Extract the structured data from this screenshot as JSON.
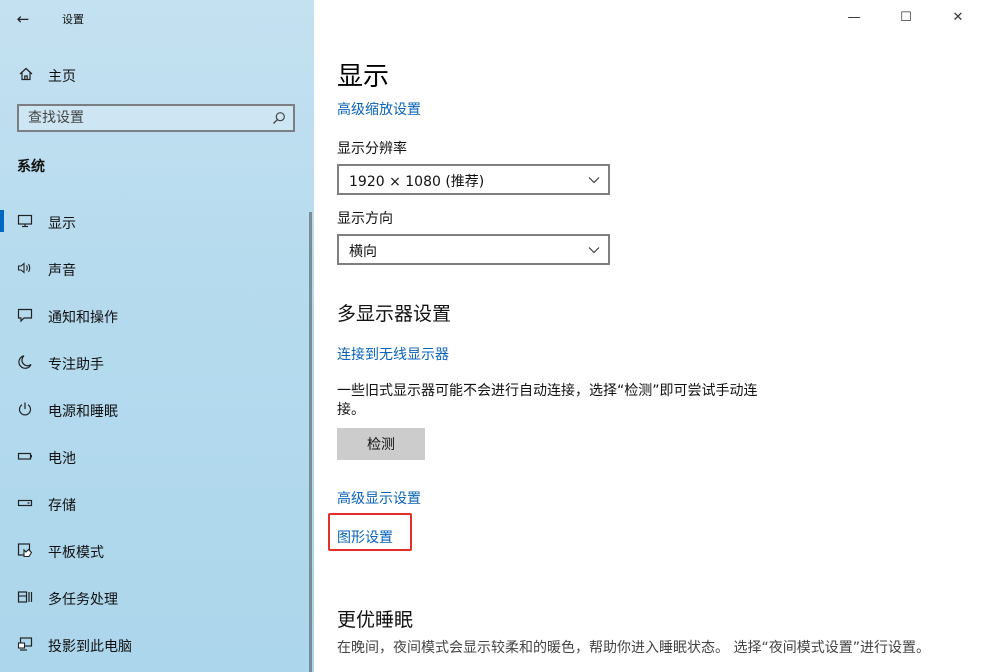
{
  "window": {
    "title": "设置",
    "back_label": "←",
    "controls": {
      "minimize": "—",
      "maximize": "☐",
      "close": "✕"
    }
  },
  "sidebar": {
    "home": {
      "label": "主页",
      "icon": "home-icon"
    },
    "search": {
      "placeholder": "查找设置",
      "value": ""
    },
    "section_title": "系统",
    "items": [
      {
        "label": "显示",
        "icon": "monitor-icon",
        "active": true
      },
      {
        "label": "声音",
        "icon": "speaker-icon",
        "active": false
      },
      {
        "label": "通知和操作",
        "icon": "notification-icon",
        "active": false
      },
      {
        "label": "专注助手",
        "icon": "moon-icon",
        "active": false
      },
      {
        "label": "电源和睡眠",
        "icon": "power-icon",
        "active": false
      },
      {
        "label": "电池",
        "icon": "battery-icon",
        "active": false
      },
      {
        "label": "存储",
        "icon": "storage-icon",
        "active": false
      },
      {
        "label": "平板模式",
        "icon": "tablet-icon",
        "active": false
      },
      {
        "label": "多任务处理",
        "icon": "multitask-icon",
        "active": false
      },
      {
        "label": "投影到此电脑",
        "icon": "project-icon",
        "active": false
      }
    ]
  },
  "main": {
    "title": "显示",
    "advanced_scaling_link": "高级缩放设置",
    "resolution": {
      "label": "显示分辨率",
      "value": "1920 × 1080 (推荐)"
    },
    "orientation": {
      "label": "显示方向",
      "value": "横向"
    },
    "multi_display": {
      "heading": "多显示器设置",
      "wireless_link": "连接到无线显示器",
      "description_line1": "一些旧式显示器可能不会进行自动连接，选择“检测”即可尝试手动连",
      "description_line2": "接。",
      "detect_button": "检测",
      "advanced_display_link": "高级显示设置",
      "graphics_link": "图形设置"
    },
    "sleep": {
      "heading": "更优睡眠",
      "description": "在晚间，夜间模式会显示较柔和的暖色，帮助你进入睡眠状态。 选择“夜间模式设置”进行设置。"
    }
  },
  "colors": {
    "sidebar_bg": "#b6dbee",
    "accent": "#0067c0",
    "link": "#0a63b8",
    "highlight": "#e0302a"
  }
}
